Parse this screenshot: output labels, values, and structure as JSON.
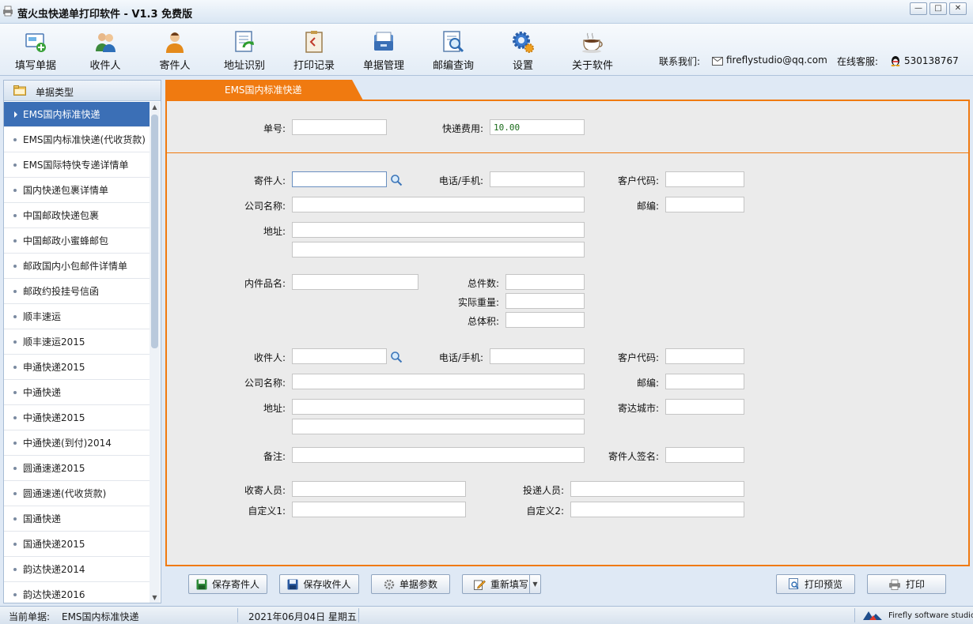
{
  "window": {
    "title": "萤火虫快递单打印软件 - V1.3 免费版",
    "controls": [
      "minimize",
      "maximize",
      "close"
    ]
  },
  "toolbar": {
    "items": [
      {
        "label": "填写单据",
        "icon": "form-fill-icon"
      },
      {
        "label": "收件人",
        "icon": "recipients-icon"
      },
      {
        "label": "寄件人",
        "icon": "sender-icon"
      },
      {
        "label": "地址识别",
        "icon": "address-recognize-icon"
      },
      {
        "label": "打印记录",
        "icon": "print-record-icon"
      },
      {
        "label": "单据管理",
        "icon": "document-manage-icon"
      },
      {
        "label": "邮编查询",
        "icon": "postcode-search-icon"
      },
      {
        "label": "设置",
        "icon": "settings-gear-icon"
      },
      {
        "label": "关于软件",
        "icon": "about-coffee-icon"
      }
    ],
    "contact_label": "联系我们:",
    "email": "fireflystudio@qq.com",
    "service_label": "在线客服:",
    "qq": "530138767"
  },
  "sidebar": {
    "header": "单据类型",
    "items": [
      "EMS国内标准快递",
      "EMS国内标准快递(代收货款)",
      "EMS国际特快专递详情单",
      "国内快递包裹详情单",
      "中国邮政快递包裹",
      "中国邮政小蜜蜂邮包",
      "邮政国内小包邮件详情单",
      "邮政约投挂号信函",
      "顺丰速运",
      "顺丰速运2015",
      "申通快递2015",
      "中通快递",
      "中通快递2015",
      "中通快递(到付)2014",
      "圆通速递2015",
      "圆通速递(代收货款)",
      "国通快递",
      "国通快递2015",
      "韵达快递2014",
      "韵达快递2016"
    ],
    "active_index": 0
  },
  "main": {
    "tab": "EMS国内标准快递",
    "labels": {
      "number": "单号:",
      "fee": "快递费用:",
      "sender": "寄件人:",
      "phone": "电话/手机:",
      "customer_code": "客户代码:",
      "company": "公司名称:",
      "postcode": "邮编:",
      "address": "地址:",
      "item_name": "内件品名:",
      "total_pieces": "总件数:",
      "actual_weight": "实际重量:",
      "total_volume": "总体积:",
      "recipient": "收件人:",
      "destination_city": "寄达城市:",
      "remarks": "备注:",
      "sender_signature": "寄件人签名:",
      "collector": "收寄人员:",
      "deliverer": "投递人员:",
      "custom1": "自定义1:",
      "custom2": "自定义2:"
    },
    "values": {
      "fee": "10.00"
    }
  },
  "buttons": {
    "save_sender": "保存寄件人",
    "save_recipient": "保存收件人",
    "doc_params": "单据参数",
    "refill": "重新填写",
    "print_preview": "打印预览",
    "print": "打印"
  },
  "statusbar": {
    "current_label": "当前单据:",
    "current_value": "EMS国内标准快递",
    "date": "2021年06月04日 星期五",
    "brand": "Firefly software studio"
  },
  "colors": {
    "accent_orange": "#f07a10",
    "selection_blue": "#3b6fb6"
  }
}
